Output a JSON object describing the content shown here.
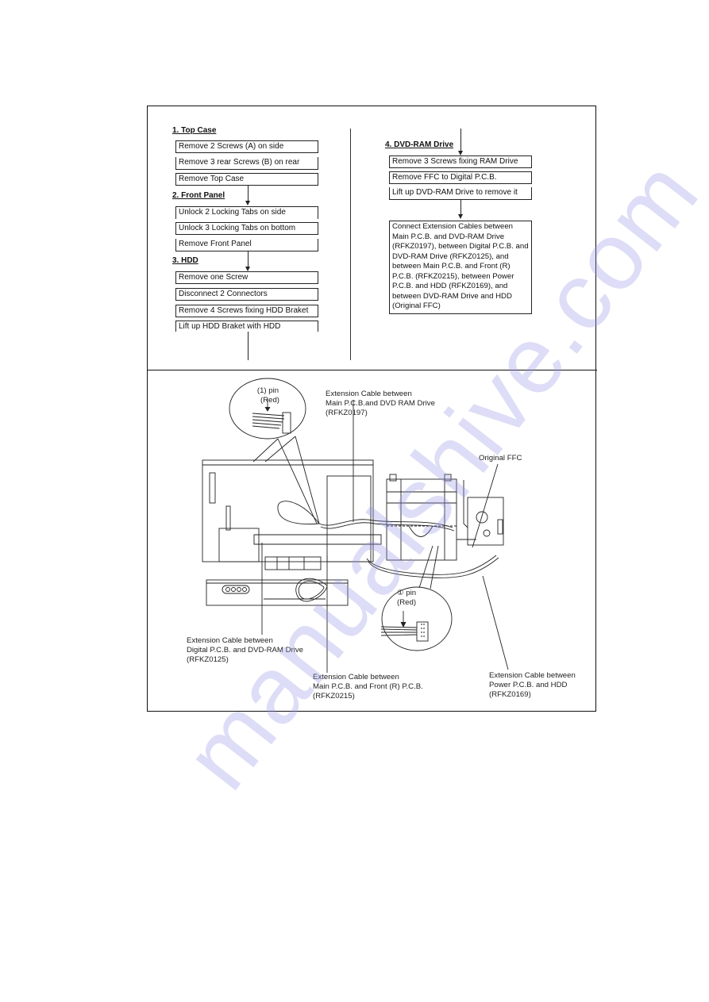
{
  "flowchart": {
    "sections": [
      {
        "heading": "1. Top Case",
        "steps": [
          "Remove 2 Screws (A) on side",
          "Remove 3 rear Screws (B) on rear",
          "Remove Top Case"
        ]
      },
      {
        "heading": "2. Front Panel",
        "steps": [
          "Unlock 2 Locking Tabs on side",
          "Unlock 3 Locking Tabs on bottom",
          "Remove Front Panel"
        ]
      },
      {
        "heading": "3. HDD",
        "steps": [
          "Remove one Screw",
          "Disconnect 2 Connectors",
          "Remove 4 Screws fixing HDD Braket",
          "Lift up HDD Braket with HDD"
        ]
      },
      {
        "heading": "4. DVD-RAM Drive",
        "steps": [
          "Remove 3 Screws fixing RAM Drive",
          "Remove FFC to Digital P.C.B.",
          "Lift up DVD-RAM Drive to remove it"
        ]
      }
    ],
    "final_step": "Connect Extension Cables between Main P.C.B. and DVD-RAM Drive (RFKZ0197), between Digital P.C.B. and DVD-RAM Drive (RFKZ0125), and between Main P.C.B. and Front (R) P.C.B. (RFKZ0215), between Power P.C.B. and HDD (RFKZ0169), and between DVD-RAM Drive and HDD (Original FFC)"
  },
  "diagram": {
    "callouts": {
      "pin1_top": {
        "line1": "(1) pin",
        "line2": "(Red)"
      },
      "pin1_bottom": {
        "line1": "① pin",
        "line2": "(Red)"
      },
      "cable_rfkz0197": {
        "line1": "Extension Cable between",
        "line2": "Main P.C.B.and DVD RAM Drive",
        "line3": "(RFKZ0197)"
      },
      "original_ffc": {
        "line1": "Original FFC"
      },
      "cable_rfkz0125": {
        "line1": "Extension Cable between",
        "line2": "Digital P.C.B. and DVD-RAM Drive",
        "line3": "(RFKZ0125)"
      },
      "cable_rfkz0215": {
        "line1": "Extension Cable between",
        "line2": "Main P.C.B. and Front (R) P.C.B.",
        "line3": "(RFKZ0215)"
      },
      "cable_rfkz0169": {
        "line1": "Extension Cable between",
        "line2": "Power P.C.B. and HDD",
        "line3": "(RFKZ0169)"
      }
    }
  },
  "watermark": "manualshive.com",
  "colors": {
    "line": "#222222",
    "watermark": "#c8c8f0"
  }
}
